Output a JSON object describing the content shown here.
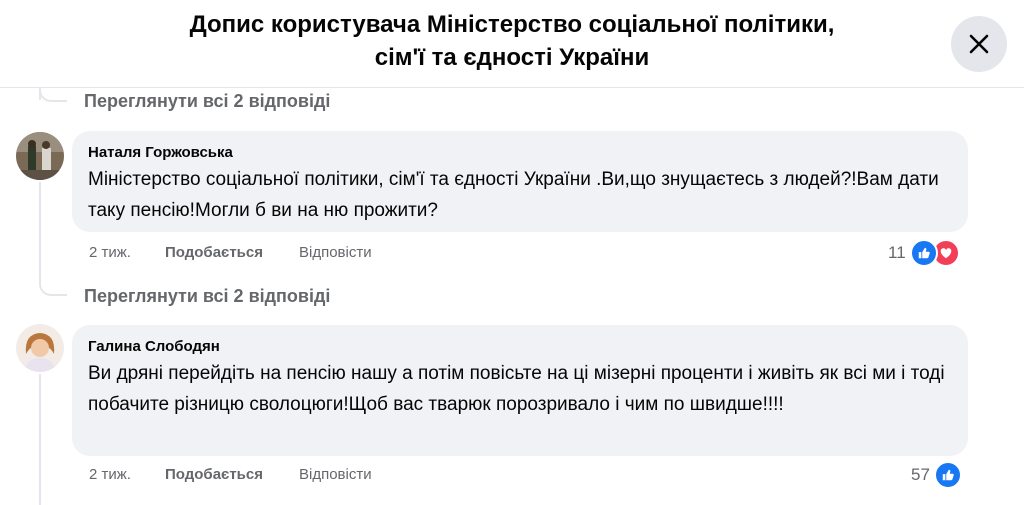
{
  "header": {
    "title_line1": "Допис користувача Міністерство соціальної політики,",
    "title_line2": "сім'ї та єдності України"
  },
  "comments": [
    {
      "view_replies": "Переглянути всі 2 відповіді"
    },
    {
      "author": "Наталя Горжовська",
      "text": "Міністерство соціальної політики, сім'ї та єдності України .Ви,що знущаєтесь з людей?!Вам дати таку пенсію!Могли б ви на ню прожити?",
      "time": "2 тиж.",
      "like_label": "Подобається",
      "reply_label": "Відповісти",
      "reaction_count": "11",
      "reactions": [
        "like-icon",
        "love-icon"
      ],
      "view_replies": "Переглянути всі 2 відповіді"
    },
    {
      "author": "Галина Слободян",
      "text": "Ви дряні перейдіть на пенсію нашу а потім повісьте на ці мізерні проценти і живіть як всі ми і тоді побачите різницю сволоцюги!Щоб вас тварюк порозривало і чим по швидше!!!!",
      "time": "2 тиж.",
      "like_label": "Подобається",
      "reply_label": "Відповісти",
      "reaction_count": "57",
      "reactions": [
        "like-icon"
      ]
    }
  ],
  "colors": {
    "like": "#1877f2",
    "love": "#f33e58",
    "bubble": "#f0f2f5",
    "secondary_text": "#65676b"
  }
}
